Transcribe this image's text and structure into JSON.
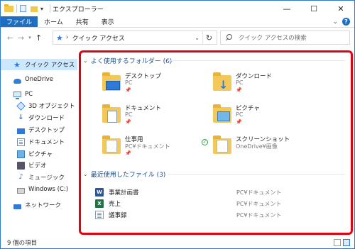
{
  "window": {
    "title": "エクスプローラー",
    "controls": {
      "minimize": "—",
      "maximize": "☐",
      "close": "✕"
    }
  },
  "ribbon": {
    "tabs": [
      "ファイル",
      "ホーム",
      "共有",
      "表示"
    ]
  },
  "address": {
    "location": "クイック アクセス",
    "search_placeholder": "クイック アクセスの検索"
  },
  "sidebar": {
    "items": [
      {
        "label": "クイック アクセス",
        "icon": "star-icon"
      },
      {
        "label": "OneDrive",
        "icon": "cloud-icon"
      },
      {
        "label": "PC",
        "icon": "pc-icon"
      },
      {
        "label": "3D オブジェクト",
        "icon": "3d-objects-icon"
      },
      {
        "label": "ダウンロード",
        "icon": "download-icon"
      },
      {
        "label": "デスクトップ",
        "icon": "desktop-icon"
      },
      {
        "label": "ドキュメント",
        "icon": "document-icon"
      },
      {
        "label": "ピクチャ",
        "icon": "picture-icon"
      },
      {
        "label": "ビデオ",
        "icon": "video-icon"
      },
      {
        "label": "ミュージック",
        "icon": "music-icon"
      },
      {
        "label": "Windows (C:)",
        "icon": "drive-icon"
      },
      {
        "label": "ネットワーク",
        "icon": "network-icon"
      }
    ]
  },
  "main": {
    "frequent_header": "よく使用するフォルダー (6)",
    "folders": [
      {
        "name": "デスクトップ",
        "location": "PC"
      },
      {
        "name": "ダウンロード",
        "location": "PC"
      },
      {
        "name": "ドキュメント",
        "location": "PC"
      },
      {
        "name": "ピクチャ",
        "location": "PC"
      },
      {
        "name": "仕事用",
        "location": "PC¥ドキュメント"
      },
      {
        "name": "スクリーンショット",
        "location": "OneDrive¥画像"
      }
    ],
    "recent_header": "最近使用したファイル (3)",
    "files": [
      {
        "name": "事業計画書",
        "location": "PC¥ドキュメント",
        "type": "word"
      },
      {
        "name": "売上",
        "location": "PC¥ドキュメント",
        "type": "excel"
      },
      {
        "name": "議事録",
        "location": "PC¥ドキュメント",
        "type": "text"
      }
    ]
  },
  "status": {
    "item_count": "9 個の項目"
  },
  "colors": {
    "accent": "#1e6fc2",
    "highlight_border": "#e60012",
    "selection": "#cce8ff"
  }
}
